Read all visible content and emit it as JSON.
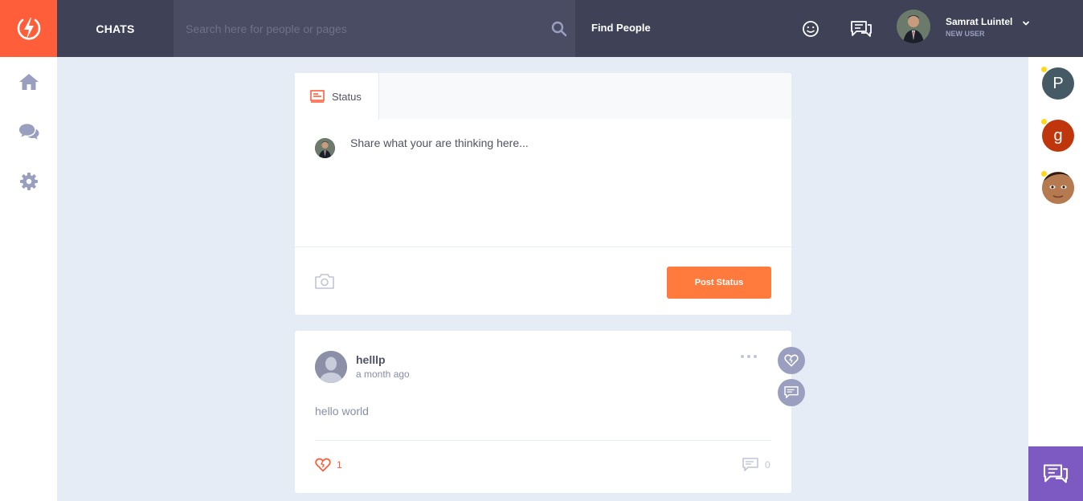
{
  "header": {
    "brand": "CHATS",
    "search_placeholder": "Search here for people or pages",
    "find_people": "Find People",
    "user": {
      "name": "Samrat Luintel",
      "role": "NEW USER"
    }
  },
  "composer": {
    "tab_label": "Status",
    "placeholder": "Share what your are thinking here...",
    "post_button": "Post Status"
  },
  "post": {
    "author": "helllp",
    "time": "a month ago",
    "body": "hello world",
    "likes": "1",
    "comments": "0"
  },
  "friends": [
    {
      "initial": "P",
      "color": "#455a64",
      "online": true
    },
    {
      "initial": "g",
      "color": "#bf360c",
      "online": true
    },
    {
      "initial": "",
      "color": "#a0683f",
      "online": true
    }
  ],
  "colors": {
    "accent": "#ff5e3a",
    "topbar": "#3f4257",
    "purple": "#7c5ac2",
    "button": "#ff7a3d",
    "background": "#e6ecf5"
  }
}
